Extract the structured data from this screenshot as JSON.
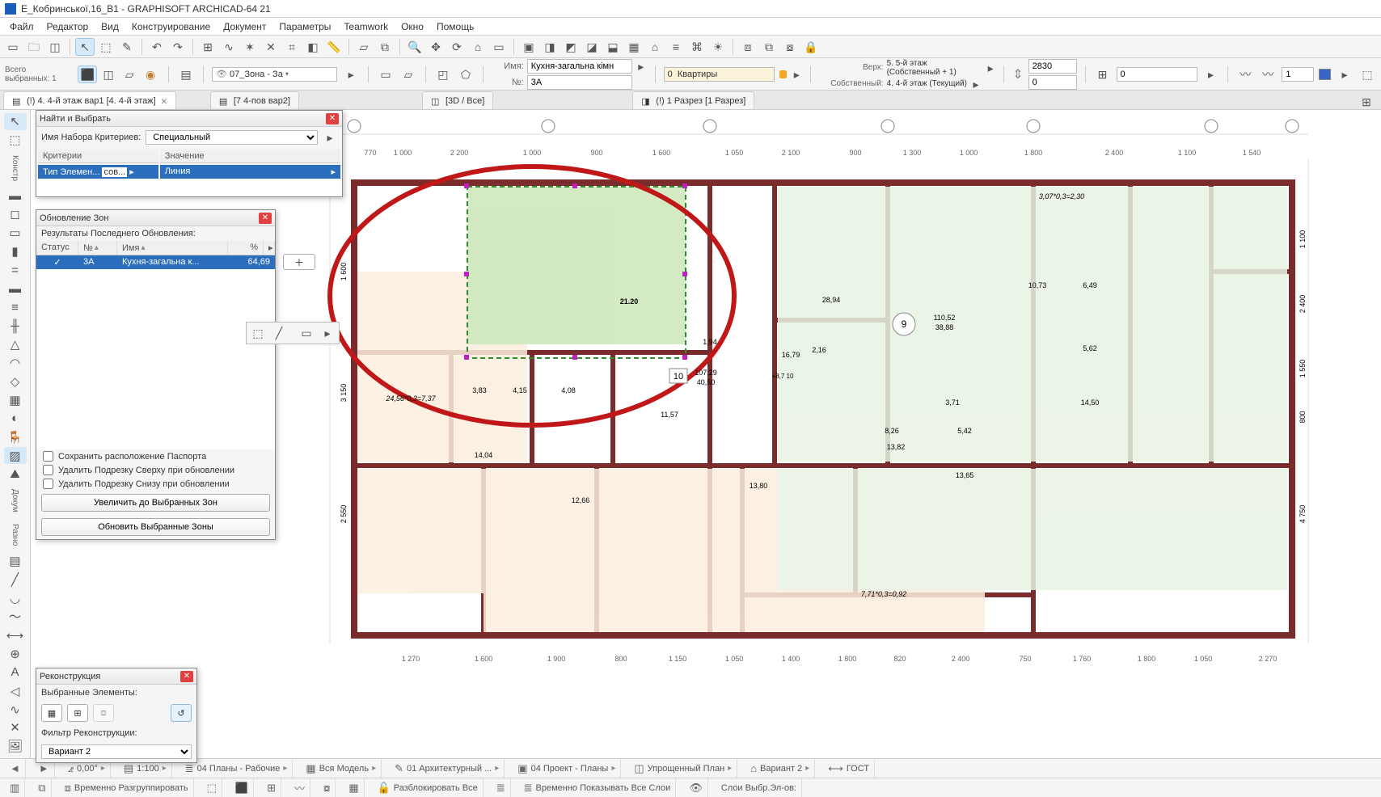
{
  "title": "Е_Кобринської,16_В1 - GRAPHISOFT ARCHICAD-64 21",
  "menu": [
    "Файл",
    "Редактор",
    "Вид",
    "Конструирование",
    "Документ",
    "Параметры",
    "Teamwork",
    "Окно",
    "Помощь"
  ],
  "selection_count_label": "Всего выбранных: 1",
  "layer_dropdown": "07_Зона - За",
  "info": {
    "name_label": "Имя:",
    "name_value": "Кухня-загальна кімн",
    "no_label": "№:",
    "no_value": "3А",
    "category_label": "Квартиры",
    "category_index": "0",
    "upper_label": "Верх:",
    "upper_value": "5. 5-й этаж (Собственный + 1)",
    "own_label": "Собственный:",
    "own_value": "4. 4-й этаж (Текущий)",
    "height_value": "2830",
    "base_value": "0",
    "dim_value": "0"
  },
  "tabs": [
    {
      "label": "(!) 4. 4-й этаж вар1 [4. 4-й этаж]",
      "active": true,
      "closeable": true,
      "icon": "plan"
    },
    {
      "label": "[7 4-пов вар2]",
      "active": false,
      "closeable": false,
      "icon": "plan"
    },
    {
      "label": "[3D / Все]",
      "active": false,
      "closeable": false,
      "icon": "3d"
    },
    {
      "label": "(!) 1 Разрез [1 Разрез]",
      "active": false,
      "closeable": false,
      "icon": "section"
    }
  ],
  "find_panel": {
    "title": "Найти и Выбрать",
    "set_name_label": "Имя Набора Критериев:",
    "set_name_value": "Специальный",
    "col_criteria": "Критерии",
    "col_value": "Значение",
    "crit_type": "Тип Элемен...",
    "crit_op": "сов...",
    "crit_value": "Линия"
  },
  "zone_panel": {
    "title": "Обновление Зон",
    "results_label": "Результаты Последнего Обновления:",
    "col_status": "Статус",
    "col_no": "№",
    "col_name": "Имя",
    "col_pct": "%",
    "row_no": "3А",
    "row_name": "Кухня-загальна к...",
    "row_pct": "64,69",
    "chk1": "Сохранить расположение Паспорта",
    "chk2": "Удалить Подрезку Сверху при обновлении",
    "chk3": "Удалить Подрезку Снизу при обновлении",
    "btn_zoom": "Увеличить до Выбранных Зон",
    "btn_update": "Обновить Выбранные Зоны"
  },
  "recon_panel": {
    "title": "Реконструкция",
    "selected_label": "Выбранные Элементы:",
    "filter_label": "Фильтр Реконструкции:",
    "filter_value": "Вариант 2"
  },
  "status_primary": {
    "angle": "0,00°",
    "scale": "1:100",
    "views": "04 Планы - Рабочие",
    "model": "Вся Модель",
    "arch": "01 Архитектурный ...",
    "proj": "04 Проект - Планы",
    "plan": "Упрощенный План",
    "variant": "Вариант 2",
    "standard": "ГОСТ"
  },
  "status_secondary": {
    "ungroup": "Временно Разгруппировать",
    "unlock": "Разблокировать Все",
    "show_all_layers": "Временно Показывать Все Слои",
    "layers_sel": "Слои Выбр.Эл-ов:"
  },
  "left_palette_labels": {
    "constr": "Констр",
    "doc": "Докум",
    "misc": "Разно"
  }
}
